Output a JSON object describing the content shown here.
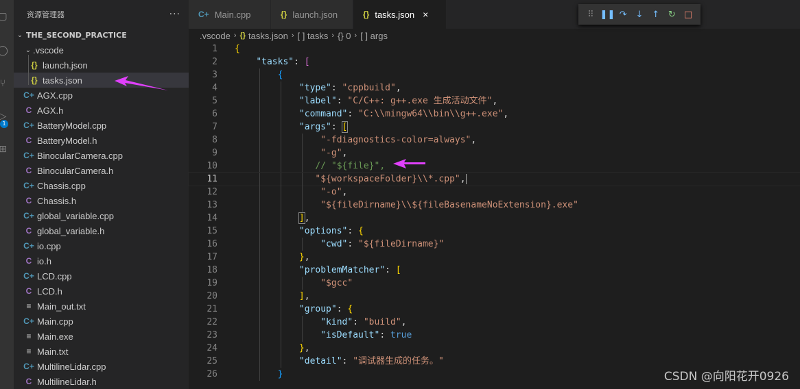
{
  "explorer": {
    "title": "资源管理器",
    "more": "···",
    "project": "THE_SECOND_PRACTICE",
    "folder": ".vscode",
    "folder_files": [
      {
        "icon": "{}",
        "name": "launch.json",
        "color": "#cbcb41"
      },
      {
        "icon": "{}",
        "name": "tasks.json",
        "color": "#cbcb41"
      }
    ],
    "files": [
      {
        "icon": "C+",
        "name": "AGX.cpp",
        "color": "#519aba"
      },
      {
        "icon": "C",
        "name": "AGX.h",
        "color": "#a074c4"
      },
      {
        "icon": "C+",
        "name": "BatteryModel.cpp",
        "color": "#519aba"
      },
      {
        "icon": "C",
        "name": "BatteryModel.h",
        "color": "#a074c4"
      },
      {
        "icon": "C+",
        "name": "BinocularCamera.cpp",
        "color": "#519aba"
      },
      {
        "icon": "C",
        "name": "BinocularCamera.h",
        "color": "#a074c4"
      },
      {
        "icon": "C+",
        "name": "Chassis.cpp",
        "color": "#519aba"
      },
      {
        "icon": "C",
        "name": "Chassis.h",
        "color": "#a074c4"
      },
      {
        "icon": "C+",
        "name": "global_variable.cpp",
        "color": "#519aba"
      },
      {
        "icon": "C",
        "name": "global_variable.h",
        "color": "#a074c4"
      },
      {
        "icon": "C+",
        "name": "io.cpp",
        "color": "#519aba"
      },
      {
        "icon": "C",
        "name": "io.h",
        "color": "#a074c4"
      },
      {
        "icon": "C+",
        "name": "LCD.cpp",
        "color": "#519aba"
      },
      {
        "icon": "C",
        "name": "LCD.h",
        "color": "#a074c4"
      },
      {
        "icon": "≡",
        "name": "Main_out.txt",
        "color": "#cccccc"
      },
      {
        "icon": "C+",
        "name": "Main.cpp",
        "color": "#519aba"
      },
      {
        "icon": "≡",
        "name": "Main.exe",
        "color": "#cccccc"
      },
      {
        "icon": "≡",
        "name": "Main.txt",
        "color": "#cccccc"
      },
      {
        "icon": "C+",
        "name": "MultilineLidar.cpp",
        "color": "#519aba"
      },
      {
        "icon": "C",
        "name": "MultilineLidar.h",
        "color": "#a074c4"
      }
    ]
  },
  "activity": {
    "badge": "1"
  },
  "tabs": [
    {
      "icon": "C+",
      "label": "Main.cpp",
      "color": "#519aba",
      "active": false
    },
    {
      "icon": "{}",
      "label": "launch.json",
      "color": "#cbcb41",
      "active": false
    },
    {
      "icon": "{}",
      "label": "tasks.json",
      "color": "#cbcb41",
      "active": true
    }
  ],
  "tab_close": "×",
  "breadcrumb": [
    ".vscode",
    "tasks.json",
    "[ ] tasks",
    "{} 0",
    "[ ] args"
  ],
  "code_lines": [
    "1",
    "2",
    "3",
    "4",
    "5",
    "6",
    "7",
    "8",
    "9",
    "10",
    "11",
    "12",
    "13",
    "14",
    "15",
    "16",
    "17",
    "18",
    "19",
    "20",
    "21",
    "22",
    "23",
    "24",
    "25",
    "26"
  ],
  "code": {
    "k_tasks": "\"tasks\"",
    "k_type": "\"type\"",
    "v_type": "\"cppbuild\"",
    "k_label": "\"label\"",
    "v_label": "\"C/C++: g++.exe 生成活动文件\"",
    "k_command": "\"command\"",
    "v_command": "\"C:\\\\mingw64\\\\bin\\\\g++.exe\"",
    "k_args": "\"args\"",
    "a1": "\"-fdiagnostics-color=always\"",
    "a2": "\"-g\"",
    "a3": "// \"${file}\",",
    "a4": "\"${workspaceFolder}\\\\*.cpp\"",
    "a5": "\"-o\"",
    "a6": "\"${fileDirname}\\\\${fileBasenameNoExtension}.exe\"",
    "k_options": "\"options\"",
    "k_cwd": "\"cwd\"",
    "v_cwd": "\"${fileDirname}\"",
    "k_pm": "\"problemMatcher\"",
    "v_pm": "\"$gcc\"",
    "k_group": "\"group\"",
    "k_kind": "\"kind\"",
    "v_kind": "\"build\"",
    "k_isdef": "\"isDefault\"",
    "v_isdef": "true",
    "k_detail": "\"detail\"",
    "v_detail": "\"调试器生成的任务。\""
  },
  "watermark": "CSDN @向阳花开0926",
  "colors": {
    "arrow": "#e040fb",
    "accent": "#007acc"
  }
}
